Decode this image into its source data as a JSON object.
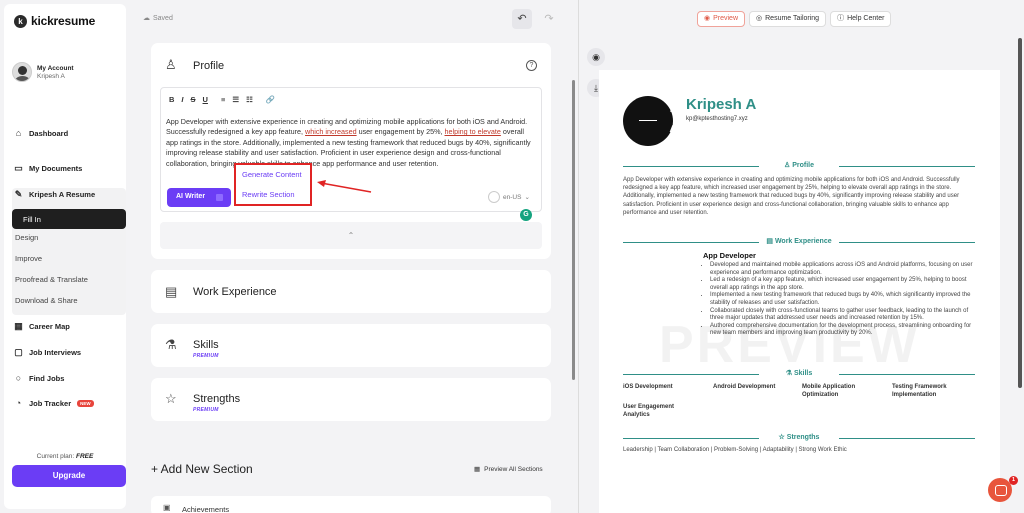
{
  "app": {
    "name": "kickresume",
    "logo_letter": "k"
  },
  "status": {
    "saved": "Saved"
  },
  "account": {
    "title": "My Account",
    "name": "Kripesh A"
  },
  "sidebar": {
    "dashboard": "Dashboard",
    "my_documents": "My Documents",
    "resume": "Kripesh A Resume",
    "sub_items": [
      "Fill In",
      "Design",
      "Improve",
      "Proofread & Translate",
      "Download & Share"
    ],
    "career_map": "Career Map",
    "job_interviews": "Job Interviews",
    "find_jobs": "Find Jobs",
    "job_tracker": "Job Tracker",
    "new_badge": "NEW",
    "plan_label": "Current plan:",
    "plan_value": "FREE",
    "upgrade": "Upgrade"
  },
  "editor": {
    "profile_title": "Profile",
    "help": "?",
    "toolbar": [
      "B",
      "I",
      "S",
      "U",
      "≡",
      "☰",
      "☷",
      "🔗"
    ],
    "text_part1": "App Developer with extensive experience in creating and optimizing mobile applications for both iOS and Android. Successfully redesigned a key app feature, ",
    "text_hl1": "which increased",
    "text_part2": " user engagement by 25%, ",
    "text_hl2": "helping to elevate",
    "text_part3": " overall app ratings in the store. Additionally, implemented a new testing framework that reduced bugs by 40%, significantly improving release stability and user satisfaction. Proficient in user experience design and cross-functional collaboration, bringing valuable skills to enhance app performance and user retention.",
    "ai_writer": "AI Writer",
    "language": "en-US",
    "popup": [
      "Generate Content",
      "Rewrite Section"
    ]
  },
  "sections": {
    "work_experience": "Work Experience",
    "skills": "Skills",
    "strengths": "Strengths",
    "premium": "PREMIUM",
    "add_new": "+ Add New Section",
    "preview_all": "Preview All Sections",
    "achievements": "Achievements"
  },
  "preview_tabs": [
    "Preview",
    "Resume Tailoring",
    "Help Center"
  ],
  "resume": {
    "initials_top": "K",
    "initials_bottom": "A",
    "name": "Kripesh A",
    "email": "kp@kptesthosting7.xyz",
    "profile_heading": "Profile",
    "profile_text": "App Developer with extensive experience in creating and optimizing mobile applications for both iOS and Android. Successfully redesigned a key app feature, which increased user engagement by 25%, helping to elevate overall app ratings in the store. Additionally, implemented a new testing framework that reduced bugs by 40%, significantly improving release stability and user satisfaction. Proficient in user experience design and cross-functional collaboration, bringing valuable skills to enhance app performance and user retention.",
    "work_heading": "Work Experience",
    "job_title": "App Developer",
    "bullets": [
      "Developed and maintained mobile applications across iOS and Android platforms, focusing on user experience and performance optimization.",
      "Led a redesign of a key app feature, which increased user engagement by 25%, helping to boost overall app ratings in the app store.",
      "Implemented a new testing framework that reduced bugs by 40%, which significantly improved the stability of releases and user satisfaction.",
      "Collaborated closely with cross-functional teams to gather user feedback, leading to the launch of three major updates that addressed user needs and increased retention by 15%.",
      "Authored comprehensive documentation for the development process, streamlining onboarding for new team members and improving team productivity by 20%."
    ],
    "watermark": "PREVIEW",
    "skills_heading": "Skills",
    "skills": [
      "iOS Development",
      "Android Development",
      "Mobile Application Optimization",
      "Testing Framework Implementation",
      "User Engagement Analytics"
    ],
    "strengths_heading": "Strengths",
    "strengths_text": "Leadership  |  Team Collaboration  |  Problem-Solving  |  Adaptability  |  Strong Work Ethic"
  },
  "chat": {
    "badge": "1"
  },
  "colors": {
    "accent": "#6b3df5",
    "resume_teal": "#2f8f87",
    "highlight_red": "#e02424"
  }
}
